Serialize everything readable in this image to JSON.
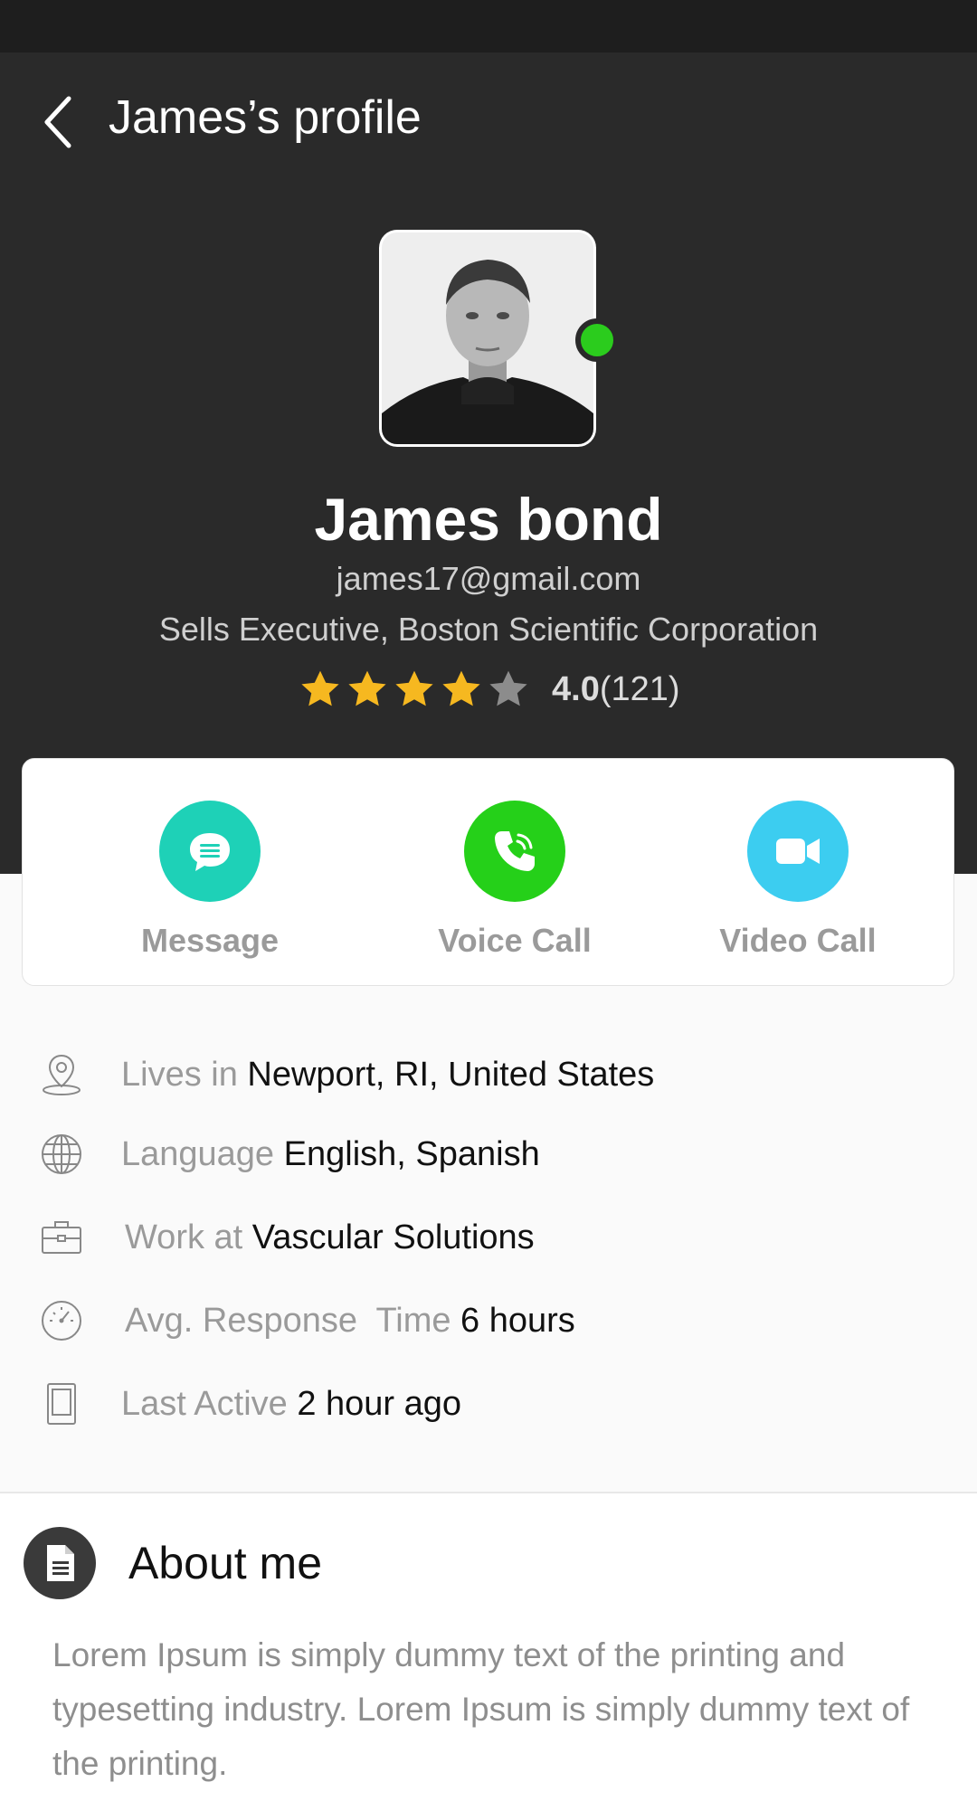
{
  "header": {
    "title": "James’s profile"
  },
  "profile": {
    "name": "James bond",
    "email": "james17@gmail.com",
    "job": "Sells Executive, Boston Scientific Corporation",
    "online": true,
    "rating": "4.0",
    "rating_count": "(121)",
    "stars_filled": 4,
    "stars_total": 5
  },
  "actions": [
    {
      "label": "Message",
      "icon": "chat-bubble-icon",
      "color": "#1ed1b7"
    },
    {
      "label": "Voice Call",
      "icon": "phone-icon",
      "color": "#25d019"
    },
    {
      "label": "Video Call",
      "icon": "video-camera-icon",
      "color": "#3ccdf0"
    }
  ],
  "info": [
    {
      "key": "Lives in ",
      "value": "Newport, RI, United States",
      "icon": "location-pin-icon"
    },
    {
      "key": "Language ",
      "value": "English, Spanish",
      "icon": "globe-icon"
    },
    {
      "key": "Work at ",
      "value": "Vascular Solutions",
      "icon": "briefcase-icon"
    },
    {
      "key": "Avg. Response  Time ",
      "value": "6 hours",
      "icon": "gauge-icon"
    },
    {
      "key": "Last Active ",
      "value": "2 hour ago",
      "icon": "phone-device-icon"
    }
  ],
  "about": {
    "title": "About me",
    "text": "Lorem Ipsum is simply dummy text of the printing and typesetting industry. Lorem Ipsum is simply dummy text of the printing."
  },
  "colors": {
    "header_bg": "#2a2a2a",
    "star": "#f6b820",
    "star_empty": "#8c8c8c",
    "online": "#2bcc1d"
  }
}
